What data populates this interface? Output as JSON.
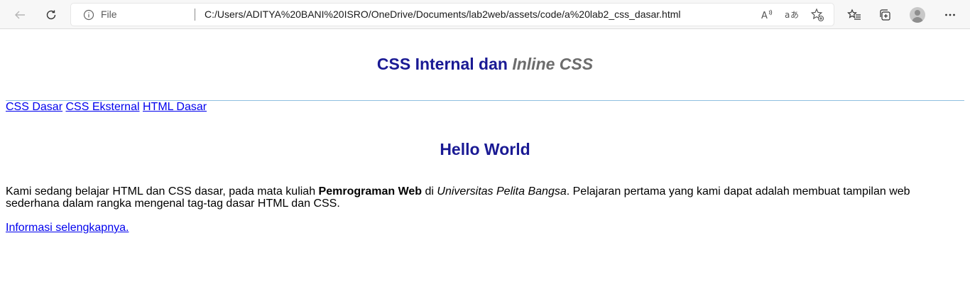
{
  "browser": {
    "address_label": "File",
    "url": "C:/Users/ADITYA%20BANI%20ISRO/OneDrive/Documents/lab2web/assets/code/a%20lab2_css_dasar.html",
    "icons": [
      "back-icon",
      "refresh-icon",
      "info-icon",
      "read-aloud-icon",
      "translate-icon",
      "add-favorite-icon",
      "favorites-icon",
      "collections-icon",
      "profile-avatar",
      "more-icon"
    ]
  },
  "header": {
    "title_main": "CSS Internal dan",
    "title_italic": "Inline",
    "title_tail": "CSS"
  },
  "nav": {
    "links": [
      "CSS Dasar",
      "CSS Eksternal",
      "HTML Dasar"
    ]
  },
  "content": {
    "heading": "Hello World",
    "para_part1": "Kami sedang belajar HTML dan CSS dasar, pada mata kuliah ",
    "para_bold": "Pemrograman Web",
    "para_part2": " di ",
    "para_italic": "Universitas Pelita Bangsa",
    "para_part3": ". Pelajaran pertama yang kami dapat adalah membuat tampilan web sederhana dalam rangka mengenal tag-tag dasar HTML dan CSS.",
    "more_link": "Informasi selengkapnya."
  },
  "colors": {
    "heading": "#1a1a94",
    "italic_gray": "#6c6c6c",
    "link": "#0000ee",
    "rule": "#8fbfe0"
  }
}
